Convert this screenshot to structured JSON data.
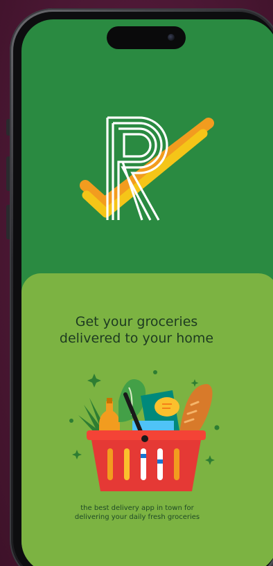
{
  "app": {
    "logo_letter": "R"
  },
  "onboarding": {
    "headline_line1": "Get your groceries",
    "headline_line2": "delivered to your home",
    "tagline_line1": "the best delivery app in town for",
    "tagline_line2": "delivering your daily fresh groceries"
  },
  "colors": {
    "background": "#4a1733",
    "top_green": "#2a8a41",
    "panel_green": "#7cb342",
    "check_yellow": "#f5c518",
    "check_orange": "#f29c1f",
    "basket_red": "#e53935"
  },
  "icons": {
    "logo": "r-checkmark-logo",
    "illustration": "grocery-basket-illustration"
  }
}
